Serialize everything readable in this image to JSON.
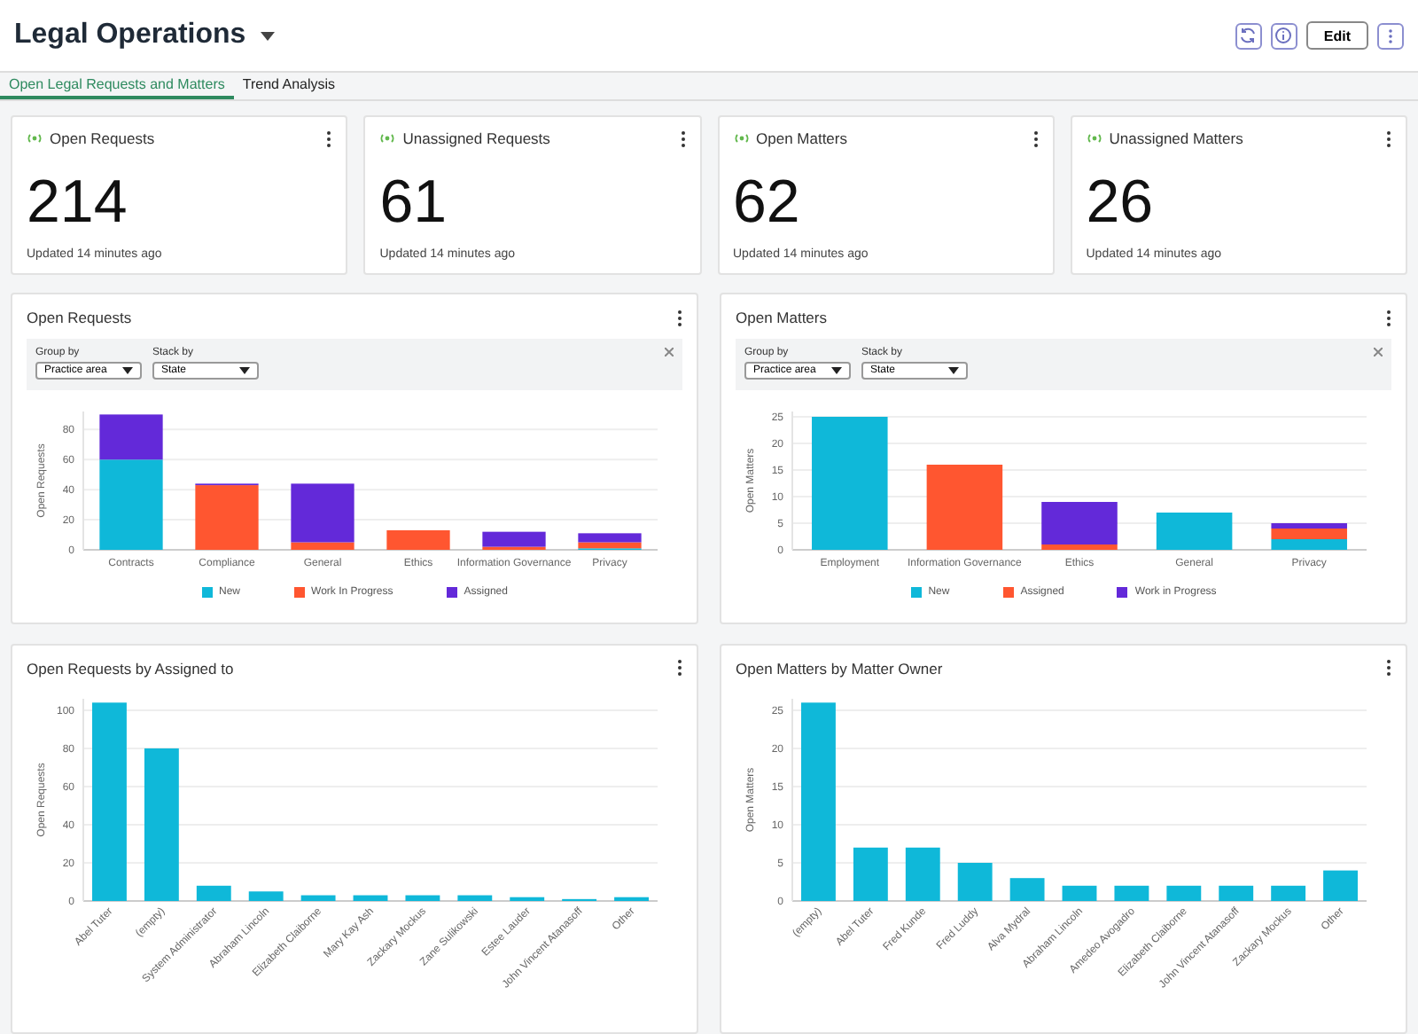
{
  "header": {
    "title": "Legal Operations",
    "edit_button": "Edit"
  },
  "tabs": [
    {
      "label": "Open Legal Requests and Matters",
      "selected": true
    },
    {
      "label": "Trend Analysis",
      "selected": false
    }
  ],
  "kpis": [
    {
      "title": "Open Requests",
      "value": "214",
      "updated": "Updated 14 minutes ago"
    },
    {
      "title": "Unassigned Requests",
      "value": "61",
      "updated": "Updated 14 minutes ago"
    },
    {
      "title": "Open Matters",
      "value": "62",
      "updated": "Updated 14 minutes ago"
    },
    {
      "title": "Unassigned Matters",
      "value": "26",
      "updated": "Updated 14 minutes ago"
    }
  ],
  "panels": [
    {
      "title": "Open Requests",
      "filters": [
        {
          "label": "Group by",
          "value": "Practice area"
        },
        {
          "label": "Stack by",
          "value": "State"
        }
      ],
      "chart_data": {
        "type": "bar",
        "stacked": true,
        "ylabel": "Open Requests",
        "categories": [
          "Contracts",
          "Compliance",
          "General",
          "Ethics",
          "Information Governance",
          "Privacy"
        ],
        "grid": true,
        "ylim": [
          0,
          92
        ],
        "yticks": [
          0,
          20,
          40,
          60,
          80
        ],
        "series": [
          {
            "name": "New",
            "color": "#0fb8d9",
            "values": [
              60,
              0,
              0,
              0,
              0,
              1
            ]
          },
          {
            "name": "Work In Progress",
            "color": "#ff5630",
            "values": [
              0,
              43,
              5,
              13,
              2,
              4
            ]
          },
          {
            "name": "Assigned",
            "color": "#6329d9",
            "values": [
              30,
              1,
              39,
              0,
              10,
              6
            ]
          }
        ]
      }
    },
    {
      "title": "Open Matters",
      "filters": [
        {
          "label": "Group by",
          "value": "Practice area"
        },
        {
          "label": "Stack by",
          "value": "State"
        }
      ],
      "chart_data": {
        "type": "bar",
        "stacked": true,
        "ylabel": "Open Matters",
        "categories": [
          "Employment",
          "Information Governance",
          "Ethics",
          "General",
          "Privacy"
        ],
        "grid": true,
        "ylim": [
          0,
          26
        ],
        "yticks": [
          0,
          5,
          10,
          15,
          20,
          25
        ],
        "series": [
          {
            "name": "New",
            "color": "#0fb8d9",
            "values": [
              25,
              0,
              0,
              7,
              2
            ]
          },
          {
            "name": "Assigned",
            "color": "#ff5630",
            "values": [
              0,
              16,
              1,
              0,
              2
            ]
          },
          {
            "name": "Work in Progress",
            "color": "#6329d9",
            "values": [
              0,
              0,
              8,
              0,
              1
            ]
          }
        ]
      }
    },
    {
      "title": "Open Requests by Assigned to",
      "chart_data": {
        "type": "bar",
        "ylabel": "Open Requests",
        "categories": [
          "Abel Tuter",
          "(empty)",
          "System Administrator",
          "Abraham Lincoln",
          "Elizabeth Claiborne",
          "Mary Kay Ash",
          "Zackary Mockus",
          "Zane Sulikowski",
          "Estee Lauder",
          "John Vincent Atanasoff",
          "Other"
        ],
        "grid": true,
        "ylim": [
          0,
          106
        ],
        "yticks": [
          0,
          20,
          40,
          60,
          80,
          100
        ],
        "series": [
          {
            "color": "#0fb8d9",
            "values": [
              104,
              80,
              8,
              5,
              3,
              3,
              3,
              3,
              2,
              1,
              2
            ]
          }
        ]
      }
    },
    {
      "title": "Open Matters by Matter Owner",
      "chart_data": {
        "type": "bar",
        "ylabel": "Open Matters",
        "categories": [
          "(empty)",
          "Abel Tuter",
          "Fred Kunde",
          "Fred Luddy",
          "Alva Mydral",
          "Abraham Lincoln",
          "Amedeo Avogadro",
          "Elizabeth Claiborne",
          "John Vincent Atanasoff",
          "Zackary Mockus",
          "Other"
        ],
        "grid": true,
        "ylim": [
          0,
          26.5
        ],
        "yticks": [
          0,
          5,
          10,
          15,
          20,
          25
        ],
        "series": [
          {
            "color": "#0fb8d9",
            "values": [
              26,
              7,
              7,
              5,
              3,
              2,
              2,
              2,
              2,
              2,
              4
            ]
          }
        ]
      }
    }
  ]
}
